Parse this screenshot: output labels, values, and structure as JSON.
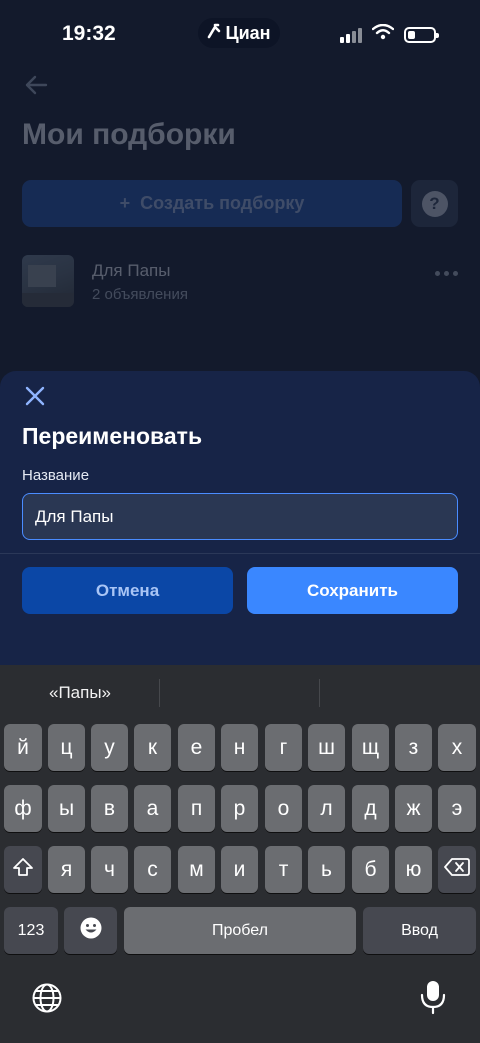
{
  "status_bar": {
    "time": "19:32",
    "carrier_pill": "Циан",
    "icons": [
      "signal-icon",
      "wifi-icon",
      "battery-icon"
    ]
  },
  "background_page": {
    "title": "Мои подборки",
    "create_button_label": "Создать подборку",
    "create_button_icon": "+",
    "help_button_label": "?",
    "collection": {
      "name": "Для Папы",
      "count": "2 объявления"
    }
  },
  "sheet": {
    "title": "Переименовать",
    "field_label": "Название",
    "field_value": "Для Папы",
    "cancel_label": "Отмена",
    "save_label": "Сохранить"
  },
  "keyboard": {
    "suggestion": "«Папы»",
    "row1": [
      "й",
      "ц",
      "у",
      "к",
      "е",
      "н",
      "г",
      "ш",
      "щ",
      "з",
      "х"
    ],
    "row2": [
      "ф",
      "ы",
      "в",
      "а",
      "п",
      "р",
      "о",
      "л",
      "д",
      "ж",
      "э"
    ],
    "row3": [
      "я",
      "ч",
      "с",
      "м",
      "и",
      "т",
      "ь",
      "б",
      "ю"
    ],
    "numbers_key": "123",
    "space_key": "Пробел",
    "return_key": "Ввод"
  },
  "colors": {
    "sheet_background": "#172447",
    "save_button": "#3a87ff",
    "cancel_button": "#0b47a6",
    "input_border": "#4a8cff",
    "keyboard_background": "#2b2d31"
  }
}
